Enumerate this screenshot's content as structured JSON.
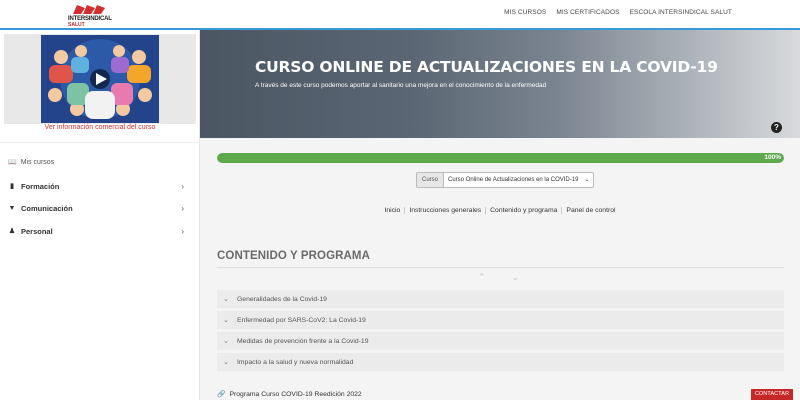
{
  "header": {
    "logo_line1": "INTERSINDICAL",
    "logo_line2": "SALUT",
    "nav": [
      "MIS CURSOS",
      "MIS CERTIFICADOS",
      "ESCOLA INTERSINDICAL SALUT"
    ]
  },
  "sidebar": {
    "info_link": "Ver información comercial del curso",
    "mis_cursos": "Mis cursos",
    "items": [
      {
        "label": "Formación",
        "icon": "book-icon"
      },
      {
        "label": "Comunicación",
        "icon": "chat-icon"
      },
      {
        "label": "Personal",
        "icon": "user-icon"
      }
    ]
  },
  "banner": {
    "title": "CURSO ONLINE DE ACTUALIZACIONES EN LA COVID-19",
    "subtitle": "A través de este curso podemos aportar al sanitario una mejora en el conocimiento de la enfermedad",
    "help": "?"
  },
  "progress": {
    "value": 1.0,
    "label": "100%"
  },
  "course_selector": {
    "label": "Curso",
    "selected": "Curso Online de Actualizaciones en la COVID-19"
  },
  "subnav": [
    "Inicio",
    "Instrucciones generales",
    "Contenido y programa",
    "Panel de control"
  ],
  "section": {
    "title": "CONTENIDO Y PROGRAMA",
    "items": [
      "Generalidades de la Covid-19",
      "Enfermedad por SARS-CoV2: La Covid-19",
      "Medidas de prevención frente a la Covid-19",
      "Impacto a la salud y nueva normalidad"
    ]
  },
  "footer": {
    "program_link": "Programa Curso COVID-19 Reedición 2022",
    "contact": "CONTACTAR"
  },
  "colors": {
    "accent_blue": "#3a9ad9",
    "progress_green": "#5ea84d",
    "brand_red": "#c62828"
  }
}
